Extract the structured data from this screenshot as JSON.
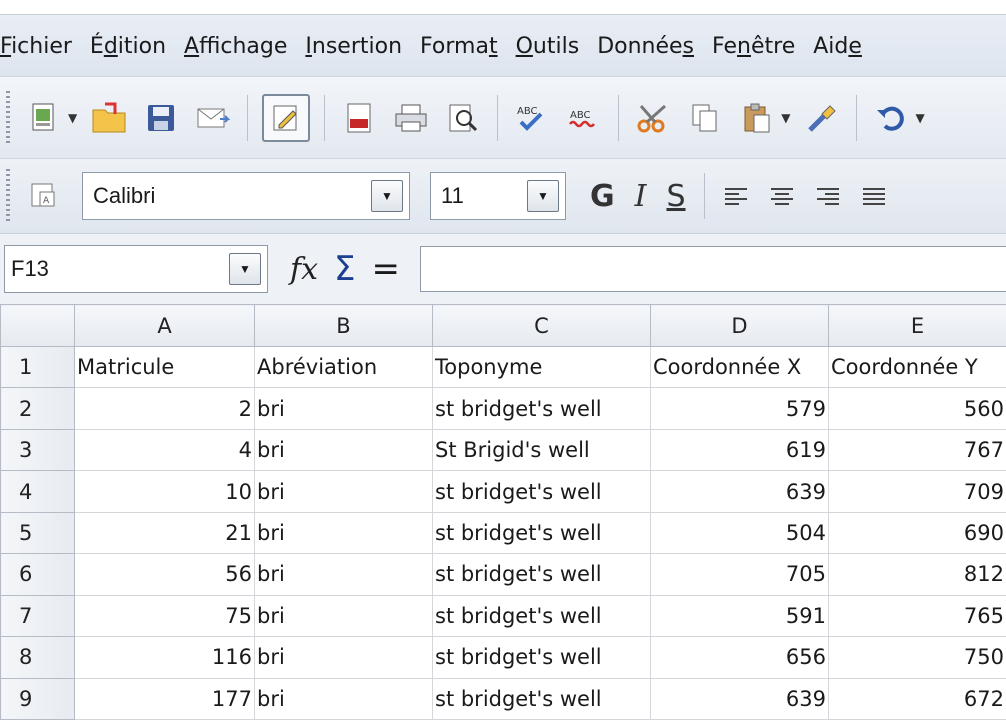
{
  "menu": {
    "items": [
      {
        "pre": "",
        "u": "F",
        "post": "ichier"
      },
      {
        "pre": "É",
        "u": "d",
        "post": "ition"
      },
      {
        "pre": "",
        "u": "A",
        "post": "ffichage"
      },
      {
        "pre": "",
        "u": "I",
        "post": "nsertion"
      },
      {
        "pre": "Forma",
        "u": "t",
        "post": ""
      },
      {
        "pre": "",
        "u": "O",
        "post": "utils"
      },
      {
        "pre": "Donnée",
        "u": "s",
        "post": ""
      },
      {
        "pre": "Fe",
        "u": "n",
        "post": "être"
      },
      {
        "pre": "Aid",
        "u": "e",
        "post": ""
      }
    ]
  },
  "formatting": {
    "font_name": "Calibri",
    "font_size": "11",
    "bold_label": "G",
    "italic_label": "I",
    "underline_label": "S"
  },
  "formula_bar": {
    "cell_ref": "F13",
    "fx_label": "fx",
    "sigma_label": "Σ",
    "equals_label": "=",
    "formula": ""
  },
  "sheet": {
    "columns": [
      "A",
      "B",
      "C",
      "D",
      "E"
    ],
    "rows": [
      {
        "n": "1",
        "a": "Matricule",
        "b": "Abréviation",
        "c": "Toponyme",
        "d": "Coordonnée X",
        "e": "Coordonnée Y"
      },
      {
        "n": "2",
        "a": "2",
        "b": "bri",
        "c": "st bridget's well",
        "d": "579",
        "e": "560"
      },
      {
        "n": "3",
        "a": "4",
        "b": "bri",
        "c": "St Brigid's well",
        "d": "619",
        "e": "767"
      },
      {
        "n": "4",
        "a": "10",
        "b": "bri",
        "c": "st bridget's well",
        "d": "639",
        "e": "709"
      },
      {
        "n": "5",
        "a": "21",
        "b": "bri",
        "c": "st bridget's well",
        "d": "504",
        "e": "690"
      },
      {
        "n": "6",
        "a": "56",
        "b": "bri",
        "c": "st bridget's well",
        "d": "705",
        "e": "812"
      },
      {
        "n": "7",
        "a": "75",
        "b": "bri",
        "c": "st bridget's well",
        "d": "591",
        "e": "765"
      },
      {
        "n": "8",
        "a": "116",
        "b": "bri",
        "c": "st bridget's well",
        "d": "656",
        "e": "750"
      },
      {
        "n": "9",
        "a": "177",
        "b": "bri",
        "c": "st bridget's well",
        "d": "639",
        "e": "672"
      }
    ]
  }
}
